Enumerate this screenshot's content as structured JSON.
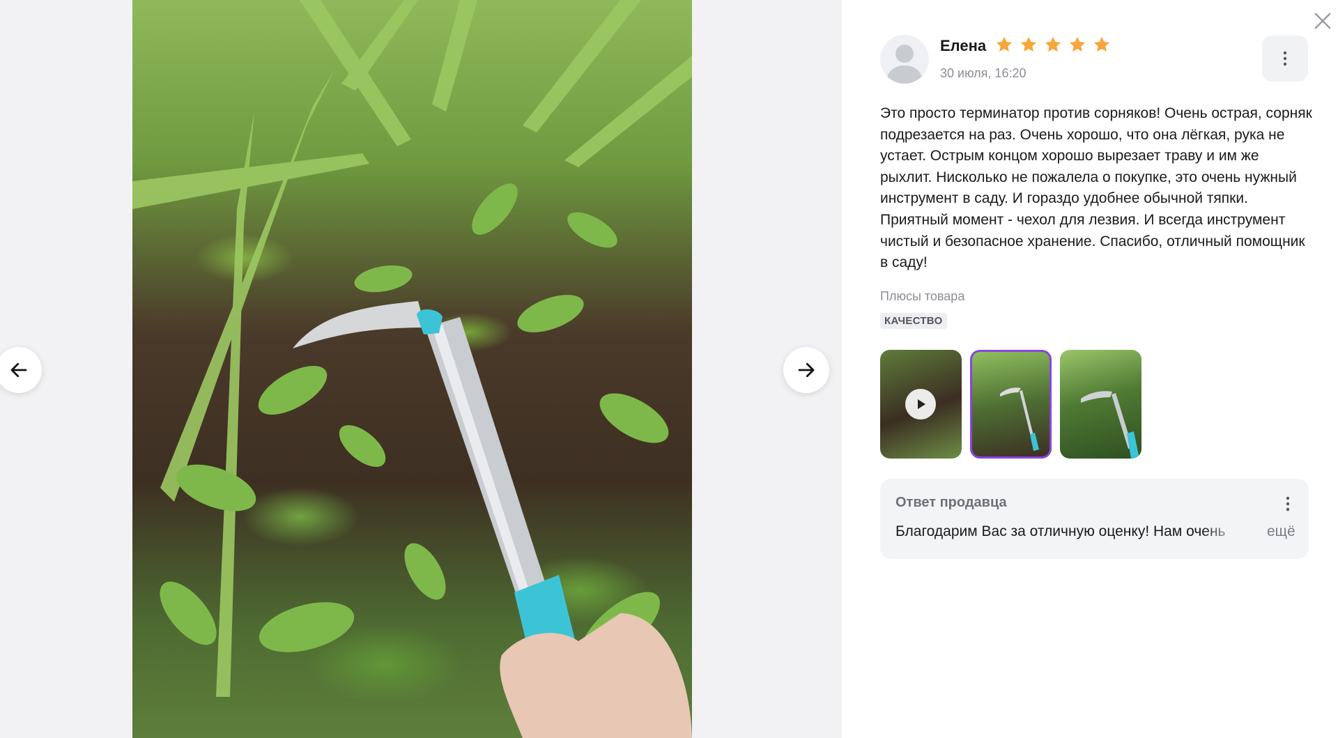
{
  "review": {
    "author": "Елена",
    "rating": 5,
    "max_rating": 5,
    "date": "30 июля, 16:20",
    "text": "Это просто терминатор против сорняков! Очень острая, сорняк подрезается на раз. Очень хорошо, что она лёгкая, рука не устает. Острым концом хорошо вырезает траву и им же рыхлит. Нисколько не пожалела о покупке, это очень нужный инструмент в саду. И гораздо удобнее обычной тяпки. Приятный момент - чехол для лезвия. И всегда инструмент чистый и безопасное хранение. Спасибо, отличный помощник в саду!",
    "pros_label": "Плюсы товара",
    "pros_tags": [
      "КАЧЕСТВО"
    ],
    "media": [
      {
        "type": "video",
        "selected": false
      },
      {
        "type": "photo",
        "selected": true
      },
      {
        "type": "photo",
        "selected": false
      }
    ]
  },
  "seller_reply": {
    "title": "Ответ продавца",
    "text": "Благодарим Вас за отличную оценку! Нам очень",
    "more_label": "ещё"
  },
  "colors": {
    "star": "#f9a53b",
    "selected_thumb_border": "#8a44e0"
  },
  "icons": {
    "prev": "arrow-left-icon",
    "next": "arrow-right-icon",
    "close": "close-icon",
    "more": "vertical-dots-icon",
    "play": "play-icon",
    "star": "star-icon",
    "avatar": "user-avatar-icon"
  }
}
